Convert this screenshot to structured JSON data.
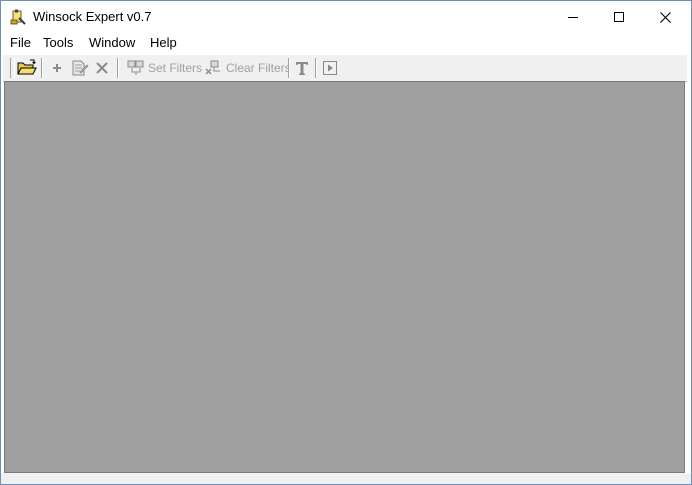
{
  "window": {
    "title": "Winsock Expert v0.7",
    "app_icon": "winsock-app-icon",
    "controls": [
      "minimize-icon",
      "maximize-icon",
      "close-icon"
    ]
  },
  "menubar": {
    "items": [
      {
        "label": "File"
      },
      {
        "label": "Tools"
      },
      {
        "label": "Window"
      },
      {
        "label": "Help"
      }
    ]
  },
  "toolbar": {
    "open_icon": "open-folder-icon",
    "add_icon": "plus-icon",
    "edit_icon": "document-edit-icon",
    "delete_icon": "delete-x-icon",
    "set_filters_label": "Set Filters",
    "set_filters_icon": "set-filters-icon",
    "clear_filters_label": "Clear Filters",
    "clear_filters_icon": "clear-filters-icon",
    "text_icon": "text-t-icon",
    "play_icon": "play-icon"
  },
  "colors": {
    "client_area": "#a0a0a0",
    "toolbar_bg": "#f0f0f0",
    "window_border": "#6e8fb5"
  }
}
